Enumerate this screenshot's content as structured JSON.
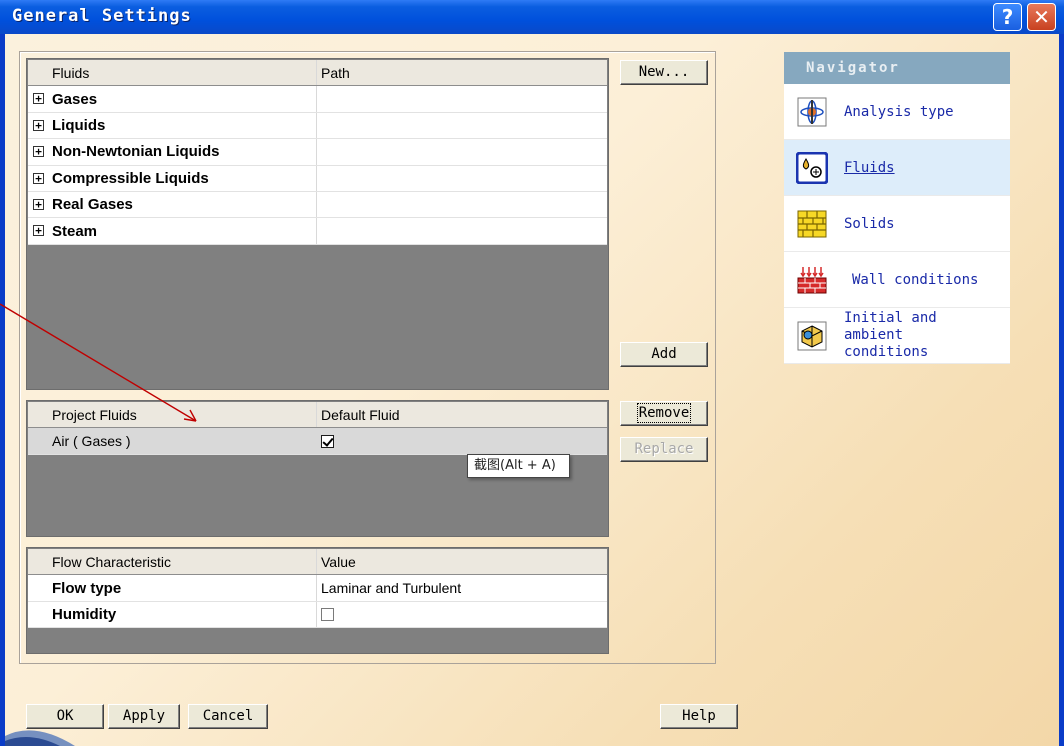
{
  "window": {
    "title": "General Settings",
    "help_glyph": "?",
    "close_glyph": "✕"
  },
  "fluids_table": {
    "headers": [
      "Fluids",
      "Path"
    ],
    "rows": [
      {
        "label": "Gases",
        "path": ""
      },
      {
        "label": "Liquids",
        "path": ""
      },
      {
        "label": "Non-Newtonian Liquids",
        "path": ""
      },
      {
        "label": "Compressible Liquids",
        "path": ""
      },
      {
        "label": "Real Gases",
        "path": ""
      },
      {
        "label": "Steam",
        "path": ""
      }
    ],
    "expander_glyph": "+"
  },
  "project_table": {
    "headers": [
      "Project Fluids",
      "Default Fluid"
    ],
    "rows": [
      {
        "label": "Air ( Gases )",
        "default": true
      }
    ]
  },
  "flow_table": {
    "headers": [
      "Flow Characteristic",
      "Value"
    ],
    "rows": [
      {
        "label": "Flow type",
        "value": "Laminar and Turbulent"
      },
      {
        "label": "Humidity",
        "value": "",
        "checkbox": false
      }
    ]
  },
  "buttons": {
    "new": "New...",
    "add": "Add",
    "remove": "Remove",
    "replace": "Replace",
    "ok": "OK",
    "apply": "Apply",
    "cancel": "Cancel",
    "help": "Help"
  },
  "navigator": {
    "title": "Navigator",
    "items": [
      {
        "label": "Analysis type",
        "icon": "analysis-type-icon"
      },
      {
        "label": "Fluids",
        "icon": "fluids-icon",
        "selected": true
      },
      {
        "label": "Solids",
        "icon": "solids-icon"
      },
      {
        "label": "Wall conditions",
        "icon": "wall-conditions-icon"
      },
      {
        "label": "Initial and ambient conditions",
        "icon": "initial-conditions-icon"
      }
    ]
  },
  "tooltip": {
    "text": "截图(Alt + A)"
  },
  "colors": {
    "title_bar": "#0050dc",
    "panel_gray": "#808080",
    "nav_header": "#86a8bf",
    "annotation_arrow": "#c00000"
  }
}
